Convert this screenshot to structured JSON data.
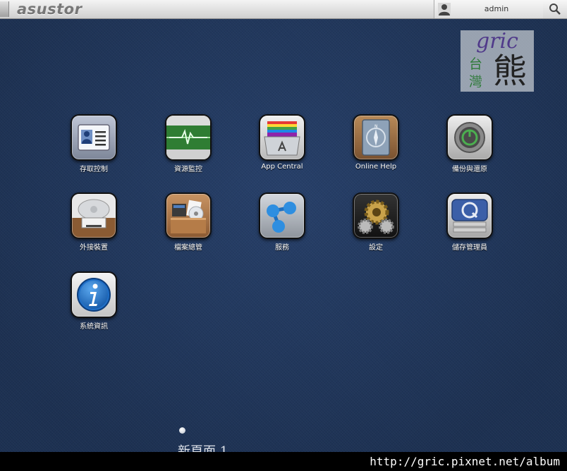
{
  "topbar": {
    "logo": "asustor",
    "username": "admin"
  },
  "watermark": {
    "gric": "gric",
    "tai": "台",
    "wan": "灣",
    "bear": "熊"
  },
  "apps": [
    {
      "label": "存取控制",
      "icon": "access-control-icon"
    },
    {
      "label": "資源監控",
      "icon": "resource-monitor-icon"
    },
    {
      "label": "App Central",
      "icon": "app-central-icon"
    },
    {
      "label": "Online Help",
      "icon": "online-help-icon"
    },
    {
      "label": "備份與還原",
      "icon": "backup-restore-icon"
    },
    {
      "label": "外接裝置",
      "icon": "external-devices-icon"
    },
    {
      "label": "檔案總管",
      "icon": "file-explorer-icon"
    },
    {
      "label": "服務",
      "icon": "services-icon"
    },
    {
      "label": "設定",
      "icon": "settings-gear-icon"
    },
    {
      "label": "儲存管理員",
      "icon": "storage-manager-icon"
    },
    {
      "label": "系統資訊",
      "icon": "system-info-icon"
    }
  ],
  "pager": {
    "label": "新頁面 1"
  },
  "footer": {
    "url": "http://gric.pixnet.net/album"
  },
  "colors": {
    "desktop_bg": "#203658",
    "topbar": "#dcdcdc",
    "label_text": "#ffffff"
  }
}
